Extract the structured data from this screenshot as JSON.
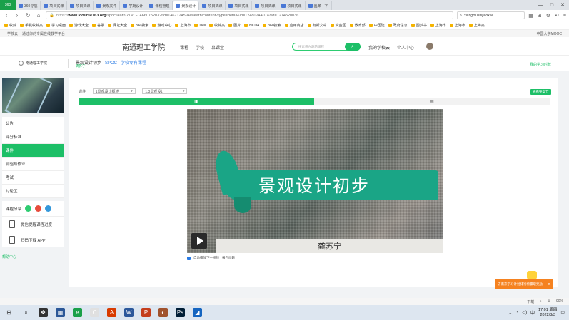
{
  "browser": {
    "badge": "360",
    "tabs": [
      {
        "label": "360导航"
      },
      {
        "label": "项目式课"
      },
      {
        "label": "项目式课"
      },
      {
        "label": "景观文件"
      },
      {
        "label": "学期设计"
      },
      {
        "label": "课程管理"
      },
      {
        "label": "景观设计",
        "active": true
      },
      {
        "label": "项目式课"
      },
      {
        "label": "项目式课"
      },
      {
        "label": "项目式课"
      },
      {
        "label": "项目式课"
      },
      {
        "label": "画廊—下"
      }
    ],
    "url_prefix": "https://",
    "url_host": "www.icourse163.org",
    "url_path": "/spoc/learn/ZLVC-1466075203?tid=1467124594#/learn/content?type=detail&id=1248024407&cid=1274520036",
    "search_value": "xiangmushijiaoxue",
    "bookmarks": [
      "收藏",
      "手机收藏夹",
      "学习桌面",
      "游戏大全",
      "谷歌",
      "网址大全",
      "360搜索",
      "游戏中心",
      "上海市",
      "Dell",
      "收藏夹",
      "图片",
      "NCDA",
      "360搜索",
      "应用商店",
      "有新文章",
      "资金区",
      "教育部",
      "中国建",
      "政府信息",
      "圆梦书",
      "上海市",
      "上海市",
      "上海高"
    ],
    "sub_left": [
      "学校云",
      "通过你的专属在线教学平台"
    ],
    "sub_right": "中国大学MOOC"
  },
  "site": {
    "school": "南通理工学院",
    "nav": [
      "课程",
      "学校",
      "慕课堂"
    ],
    "search_placeholder": "搜索感兴趣的课程",
    "user_links": [
      "我的学校云",
      "个人中心"
    ]
  },
  "course": {
    "logo_text": "南通理工学院",
    "title": "景观设计初步",
    "teacher": "龚苏宁",
    "spoc_label": "SPOC | 学校专有课程",
    "study_time_label": "我的学习时长"
  },
  "sidebar": {
    "items": [
      {
        "label": "公告"
      },
      {
        "label": "评分标准"
      },
      {
        "label": "课件",
        "active": true
      },
      {
        "label": "测验与作业"
      },
      {
        "label": "考试"
      },
      {
        "label": "讨论区"
      }
    ],
    "share_label": "课程分享",
    "share_colors": [
      "#2ecc71",
      "#e74c3c",
      "#3498db"
    ],
    "wechat_label": "微信提醒课程进度",
    "app_label": "扫码下载 APP",
    "feedback": "帮助中心"
  },
  "content": {
    "crumb_root": "课件",
    "chapter_select": "1景观设计概述",
    "unit_select": "1.3景观设计",
    "chapter_button": "查看整章节",
    "tab_video_icon": "▣",
    "tab_doc_icon": "▤",
    "video_title": "景观设计初步",
    "video_author": "龚苏宁",
    "autoplay_label": "自动播放下一视频",
    "report_label": "报告问题"
  },
  "promo": {
    "text": "去南京学习计划排行榜赢取奖励"
  },
  "status_strip": [
    "下载",
    "",
    "",
    "90%"
  ],
  "taskbar": {
    "apps": [
      "⊞",
      "⌕",
      "❖",
      "▦",
      "e",
      "C",
      "A",
      "W",
      "P",
      "◐",
      "Ps",
      "◢"
    ],
    "time": "17:01 周四",
    "date": "2022/3/3",
    "ime": "中"
  }
}
